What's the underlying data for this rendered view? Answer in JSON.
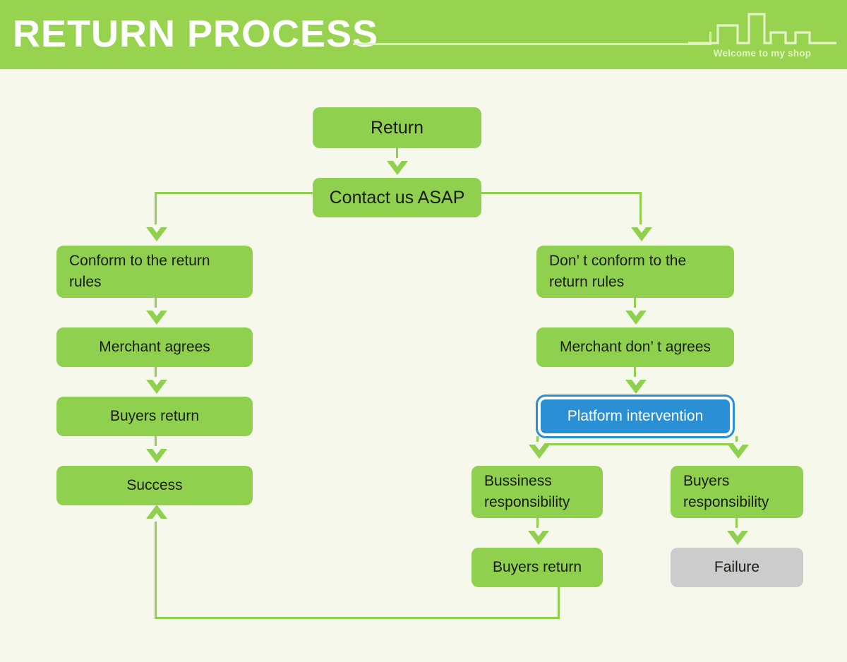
{
  "header": {
    "title": "RETURN PROCESS",
    "logo_caption": "Welcome to my shop",
    "logo_icon": "city-skyline-icon",
    "band_color": "#97d34f",
    "title_color": "#ffffff"
  },
  "theme": {
    "background": "#f6f8ec",
    "node_green": "#8fd14f",
    "node_gray": "#cccccc",
    "node_blue": "#2b8fd4",
    "connector_green": "#8fd14f",
    "text_dark": "#1b1b14"
  },
  "flowchart": {
    "title": "Return Process",
    "type": "flowchart",
    "nodes": [
      {
        "id": "return",
        "label": "Return",
        "color": "green",
        "align": "center"
      },
      {
        "id": "contact",
        "label": "Contact us ASAP",
        "color": "green",
        "align": "center"
      },
      {
        "id": "conform",
        "label": "Conform to the return rules",
        "color": "green",
        "align": "left"
      },
      {
        "id": "merchant-agrees",
        "label": "Merchant agrees",
        "color": "green",
        "align": "center"
      },
      {
        "id": "buyers-return-l",
        "label": "Buyers return",
        "color": "green",
        "align": "center"
      },
      {
        "id": "success",
        "label": "Success",
        "color": "green",
        "align": "center"
      },
      {
        "id": "not-conform",
        "label": "Don’ t conform to the return rules",
        "color": "green",
        "align": "left"
      },
      {
        "id": "merchant-disagree",
        "label": "Merchant don’ t agrees",
        "color": "green",
        "align": "center"
      },
      {
        "id": "platform",
        "label": "Platform intervention",
        "color": "blue",
        "align": "center"
      },
      {
        "id": "business-resp",
        "label": "Bussiness responsibility",
        "color": "green",
        "align": "left"
      },
      {
        "id": "buyers-return-r",
        "label": "Buyers return",
        "color": "green",
        "align": "center"
      },
      {
        "id": "buyers-resp",
        "label": "Buyers responsibility",
        "color": "green",
        "align": "left"
      },
      {
        "id": "failure",
        "label": "Failure",
        "color": "gray",
        "align": "center"
      }
    ],
    "edges": [
      {
        "from": "return",
        "to": "contact"
      },
      {
        "from": "contact",
        "to": "conform"
      },
      {
        "from": "contact",
        "to": "not-conform"
      },
      {
        "from": "conform",
        "to": "merchant-agrees"
      },
      {
        "from": "merchant-agrees",
        "to": "buyers-return-l"
      },
      {
        "from": "buyers-return-l",
        "to": "success"
      },
      {
        "from": "not-conform",
        "to": "merchant-disagree"
      },
      {
        "from": "merchant-disagree",
        "to": "platform"
      },
      {
        "from": "platform",
        "to": "business-resp"
      },
      {
        "from": "platform",
        "to": "buyers-resp"
      },
      {
        "from": "business-resp",
        "to": "buyers-return-r"
      },
      {
        "from": "buyers-resp",
        "to": "failure"
      },
      {
        "from": "buyers-return-r",
        "to": "success"
      }
    ]
  }
}
